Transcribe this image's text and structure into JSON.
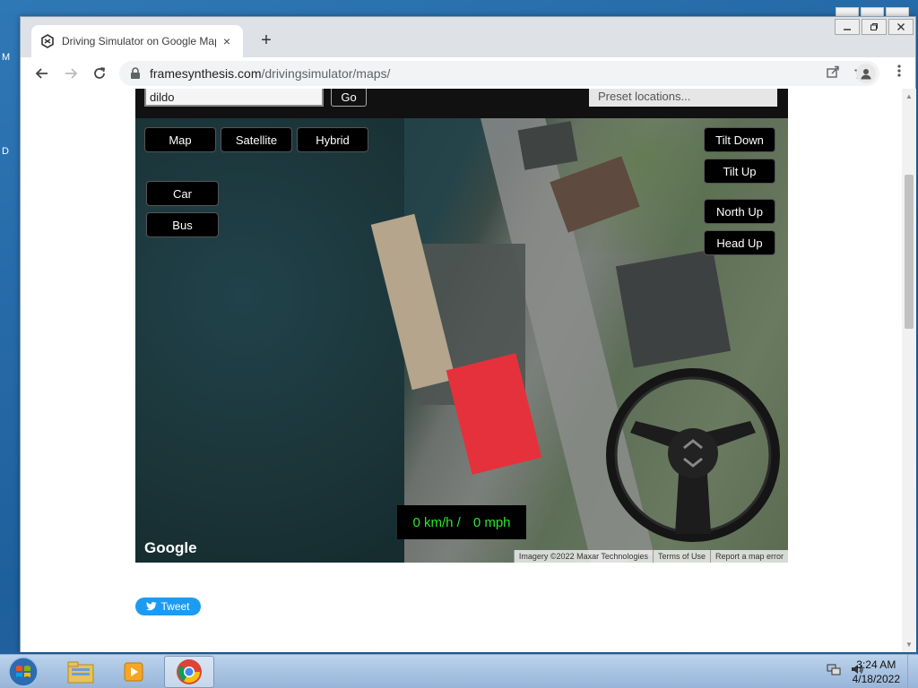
{
  "browser": {
    "tab_title": "Driving Simulator on Google Maps",
    "url_host": "framesynthesis.com",
    "url_path": "/drivingsimulator/maps/",
    "new_tab": "+",
    "tab_close": "×"
  },
  "desktop": {
    "label_top": "M",
    "label_mid": "D"
  },
  "controls": {
    "search_value": "dildo",
    "go_label": "Go",
    "preset_placeholder": "Preset locations..."
  },
  "map_types": [
    "Map",
    "Satellite",
    "Hybrid"
  ],
  "vehicles": [
    "Car",
    "Bus"
  ],
  "camera": {
    "tilt_down": "Tilt Down",
    "tilt_up": "Tilt Up",
    "north_up": "North Up",
    "head_up": "Head Up"
  },
  "speed": {
    "kmh": "0 km/h /",
    "mph": "0 mph"
  },
  "map_footer": {
    "logo": "Google",
    "imagery": "Imagery ©2022 Maxar Technologies",
    "terms": "Terms of Use",
    "report": "Report a map error"
  },
  "social": {
    "tweet_label": "Tweet"
  },
  "taskbar": {
    "time": "3:24 AM",
    "date": "4/18/2022"
  },
  "colors": {
    "speed_text": "#2ce62c",
    "tweet": "#1d9bf0",
    "car_roof": "#e5313b",
    "orange_bar": "#f26b21"
  }
}
